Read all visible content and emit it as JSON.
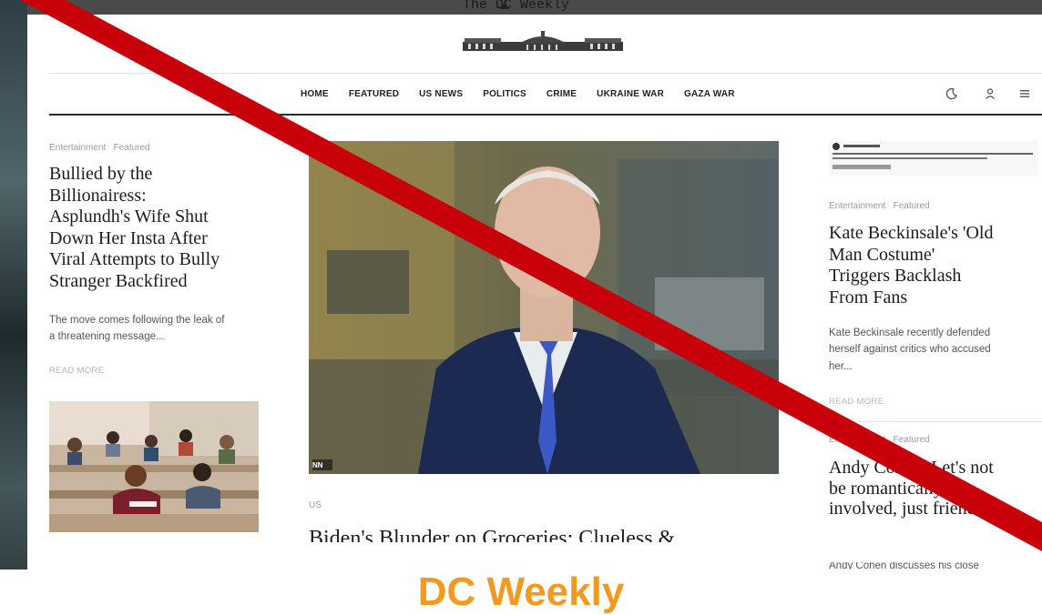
{
  "site": {
    "title": "The DC Weekly"
  },
  "nav": {
    "items": [
      "HOME",
      "FEATURED",
      "US NEWS",
      "POLITICS",
      "CRIME",
      "UKRAINE WAR",
      "GAZA WAR"
    ]
  },
  "header_icons": [
    "moon-icon",
    "user-icon",
    "menu-icon"
  ],
  "left_article": {
    "categories": "Entertainment   Featured",
    "headline_lines": [
      "Bullied by the",
      "Billionairess:",
      "Asplundh's Wife Shut",
      "Down Her Insta After",
      "Viral Attempts to Bully",
      "Stranger Backfired"
    ],
    "excerpt_lines": [
      "The move comes following the leak of",
      "a threatening message..."
    ],
    "read_more": "READ MORE"
  },
  "main_article": {
    "video_badge": "NN",
    "category": "US",
    "headline": "Biden's Blunder on Groceries: Clueless &"
  },
  "right_article_1": {
    "categories": "Entertainment   Featured",
    "headline_lines": [
      "Kate Beckinsale's 'Old",
      "Man Costume'",
      "Triggers Backlash",
      "From Fans"
    ],
    "excerpt_lines": [
      "Kate Beckinsale recently defended",
      "herself against critics who accused",
      "her..."
    ],
    "read_more": "READ MORE"
  },
  "right_article_2": {
    "categories": "Entertainment   Featured",
    "headline_lines": [
      "Andy Cohen: Let's not",
      "be romantically",
      "involved, just friends"
    ],
    "excerpt": "Andy Cohen discusses his close"
  },
  "footer": {
    "brand": "DC Weekly"
  },
  "colors": {
    "slash": "#c8000a",
    "brand_orange": "#f29a1d",
    "nav_rule": "#2b2b2b"
  }
}
